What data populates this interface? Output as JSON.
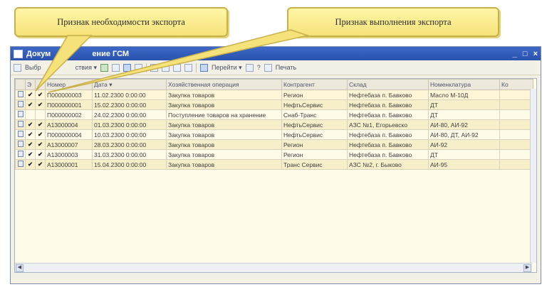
{
  "callouts": {
    "left": "Признак необходимости экспорта",
    "right": "Признак выполнения экспорта"
  },
  "window": {
    "title_start": "Докум",
    "title_end": "ение ГСМ",
    "controls": [
      "_",
      "□",
      "×"
    ]
  },
  "toolbar": {
    "select_label": "Выбр",
    "actions_label": "ствия",
    "goto_label": "Перейти",
    "print_label": "Печать",
    "help_label": "?"
  },
  "table": {
    "columns": [
      "",
      "Э",
      "",
      "Номер",
      "Дата",
      "Хозяйственная операция",
      "Контрагент",
      "Склад",
      "Номенклатура",
      "Ко"
    ],
    "rows": [
      {
        "export_needed": "✔",
        "export_done": "✔",
        "number": "П000000003",
        "date": "11.02.2300 0:00:00",
        "operation": "Закупка товаров",
        "counterparty": "Регион",
        "warehouse": "Нефтебаза п. Бавково",
        "nomenclature": "Масло М-10Д",
        "qty": ""
      },
      {
        "export_needed": "✔",
        "export_done": "✔",
        "number": "П000000001",
        "date": "15.02.2300 0:00:00",
        "operation": "Закупка товаров",
        "counterparty": "НефтьСервис",
        "warehouse": "Нефтебаза п. Бавково",
        "nomenclature": "ДТ",
        "qty": ""
      },
      {
        "export_needed": "",
        "export_done": "",
        "number": "П000000002",
        "date": "24.02.2300 0:00:00",
        "operation": "Поступление товаров на хранение",
        "counterparty": "Снаб-Транс",
        "warehouse": "Нефтебаза п. Бавково",
        "nomenclature": "ДТ",
        "qty": ""
      },
      {
        "export_needed": "✔",
        "export_done": "✔",
        "number": "А13000004",
        "date": "01.03.2300 0:00:00",
        "operation": "Закупка товаров",
        "counterparty": "НефтьСервис",
        "warehouse": "АЗС №1, Егорьевско",
        "nomenclature": "АИ-80, АИ-92",
        "qty": ""
      },
      {
        "export_needed": "✔",
        "export_done": "✔",
        "number": "П000000004",
        "date": "10.03.2300 0:00:00",
        "operation": "Закупка товаров",
        "counterparty": "НефтьСервис",
        "warehouse": "Нефтебаза п. Бавково",
        "nomenclature": "АИ-80, ДТ, АИ-92",
        "qty": ""
      },
      {
        "export_needed": "✔",
        "export_done": "✔",
        "number": "А13000007",
        "date": "28.03.2300 0:00:00",
        "operation": "Закупка товаров",
        "counterparty": "Регион",
        "warehouse": "Нефтебаза п. Бавково",
        "nomenclature": "АИ-92",
        "qty": ""
      },
      {
        "export_needed": "✔",
        "export_done": "✔",
        "number": "А13000003",
        "date": "31.03.2300 0:00:00",
        "operation": "Закупка товаров",
        "counterparty": "Регион",
        "warehouse": "Нефтебаза п. Бавково",
        "nomenclature": "ДТ",
        "qty": ""
      },
      {
        "export_needed": "✔",
        "export_done": "✔",
        "number": "А13000001",
        "date": "15.04.2300 0:00:00",
        "operation": "Закупка товаров",
        "counterparty": "Транс Сервис",
        "warehouse": "АЗС №2, г. Быково",
        "nomenclature": "АИ-95",
        "qty": ""
      }
    ]
  },
  "colors": {
    "callout_fill": "#f6e27a",
    "titlebar": "#2a53ad",
    "row_alt": "#f7efca"
  }
}
